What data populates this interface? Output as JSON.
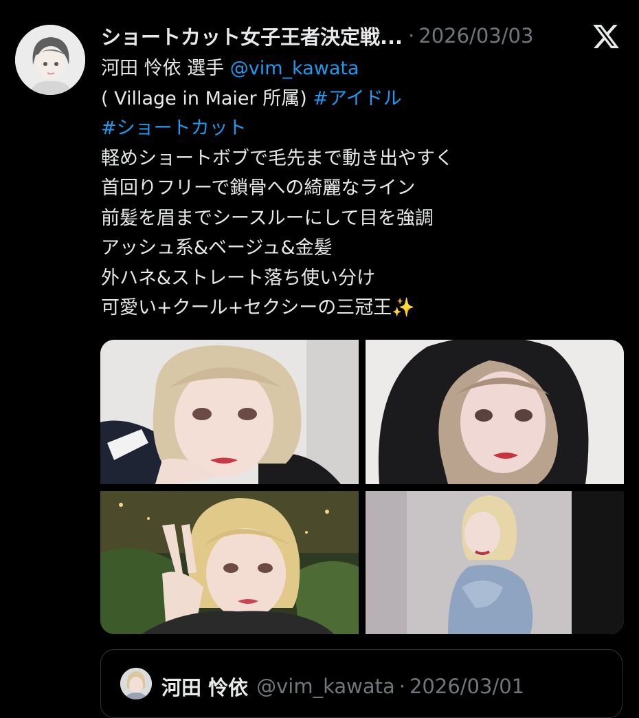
{
  "tweet": {
    "author_name": "ショートカット女子王者決定戦...",
    "separator": "·",
    "date": "2026/03/03",
    "lines": [
      {
        "text": "河田 怜依 選手 ",
        "link": "@vim_kawata"
      },
      {
        "text": "( Village in Maier 所属) ",
        "link": "#アイドル"
      },
      {
        "text": "",
        "link": "#ショートカット"
      },
      {
        "text": "軽めショートボブで毛先まで動き出やすく"
      },
      {
        "text": "首回りフリーで鎖骨への綺麗なライン"
      },
      {
        "text": "前髪を眉までシースルーにして目を強調"
      },
      {
        "text": "アッシュ系&ベージュ&金髪"
      },
      {
        "text": "外ハネ&ストレート落ち使い分け"
      },
      {
        "text": "可愛い+クール+セクシーの三冠王✨"
      }
    ],
    "platform_icon": "x-logo-icon",
    "photo_count": 4
  },
  "quote": {
    "author_name": "河田 怜依",
    "handle": "@vim_kawata",
    "separator": "·",
    "date": "2026/03/01"
  },
  "colors": {
    "background": "#000000",
    "text": "#e7e9ea",
    "muted": "#71767b",
    "link": "#1d9bf0",
    "border": "#2f3336"
  }
}
